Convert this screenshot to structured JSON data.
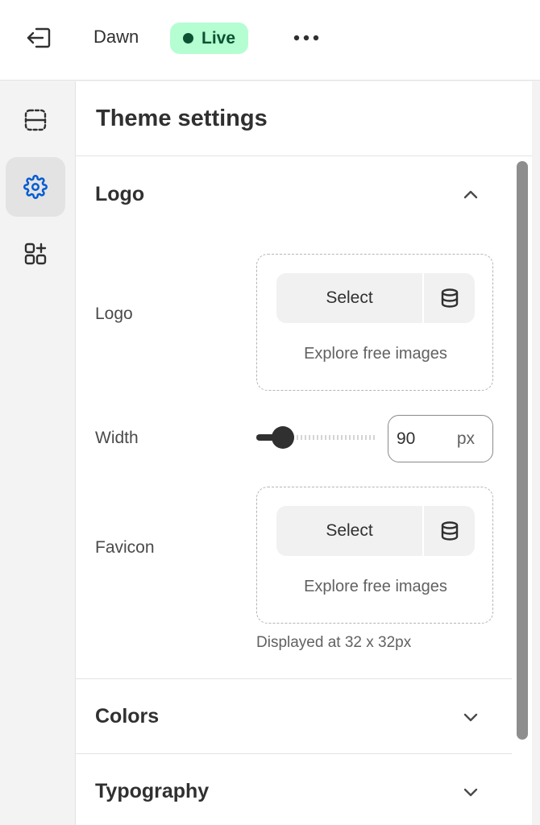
{
  "topbar": {
    "exit_icon": "exit-icon",
    "theme_name": "Dawn",
    "status_badge": "Live",
    "more_icon": "more-horizontal-icon"
  },
  "rail": {
    "items": [
      {
        "icon": "sections-icon"
      },
      {
        "icon": "gear-icon",
        "active": true
      },
      {
        "icon": "apps-add-icon"
      }
    ]
  },
  "panel": {
    "title": "Theme settings",
    "sections": [
      {
        "title": "Logo",
        "expanded": true
      },
      {
        "title": "Colors",
        "expanded": false
      },
      {
        "title": "Typography",
        "expanded": false
      }
    ],
    "logo_field": {
      "label": "Logo",
      "select_label": "Select",
      "explore_label": "Explore free images"
    },
    "width_field": {
      "label": "Width",
      "value": "90",
      "unit": "px",
      "slider_fraction": 0.22
    },
    "favicon_field": {
      "label": "Favicon",
      "select_label": "Select",
      "explore_label": "Explore free images",
      "help": "Displayed at 32 x 32px"
    }
  },
  "colors": {
    "live_badge_bg": "#b4fed2",
    "live_text": "#0c5132",
    "accent_icon": "#005bd3"
  }
}
